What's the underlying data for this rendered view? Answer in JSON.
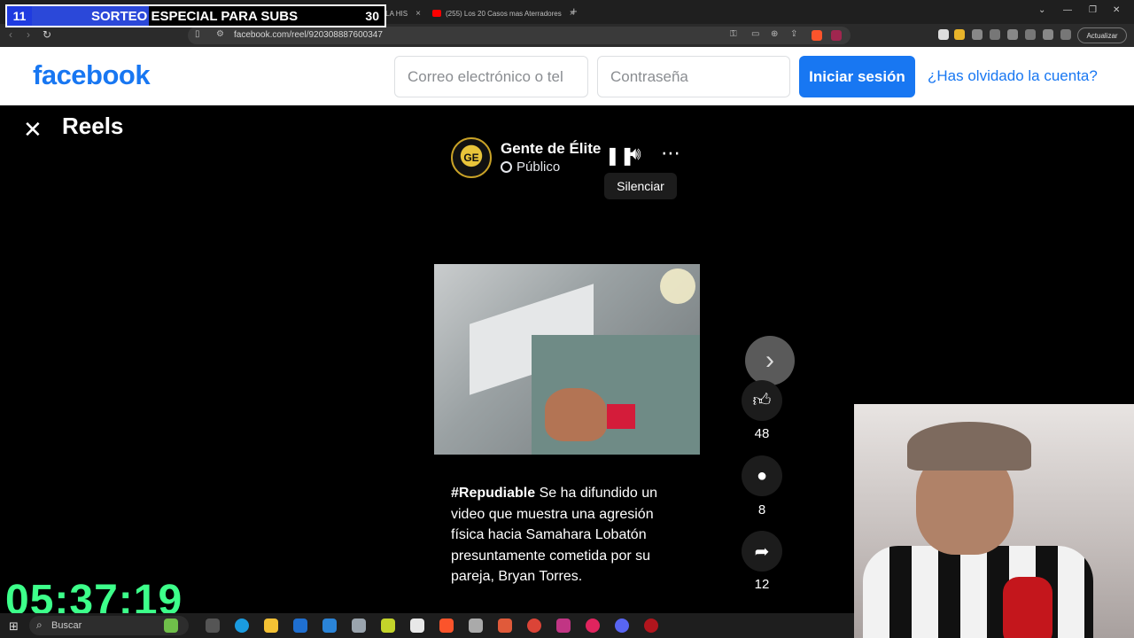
{
  "browser": {
    "tabs": [
      {
        "title": "(255) EL PEOR JUGADOR DE LA HIS"
      },
      {
        "title": "(255) Los 20 Casos mas Aterradores"
      }
    ],
    "url": "facebook.com/reel/920308887600347",
    "update_label": "Actualizar"
  },
  "banner": {
    "left_num": "11",
    "text": "SORTEO ESPECIAL PARA SUBS",
    "right_num": "30"
  },
  "header": {
    "logo": "facebook",
    "email_placeholder": "Correo electrónico o tel",
    "password_placeholder": "Contraseña",
    "login_label": "Iniciar sesión",
    "forgot_label": "¿Has olvidado la cuenta?"
  },
  "reels": {
    "title": "Reels",
    "page_name": "Gente de Élite",
    "avatar_text": "GE",
    "privacy": "Público",
    "tooltip": "Silenciar",
    "caption_tag": "#Repudiable",
    "caption_text": " Se ha difundido un video que muestra una agresión física hacia Samahara Lobatón presuntamente cometida por su pareja, Bryan Torres.",
    "likes": "48",
    "comments": "8",
    "shares": "12"
  },
  "overlay": {
    "timer": "05:37:19"
  },
  "taskbar": {
    "search_label": "Buscar"
  },
  "colors": {
    "fb_blue": "#1877f2",
    "timer_green": "#3dff8a"
  }
}
